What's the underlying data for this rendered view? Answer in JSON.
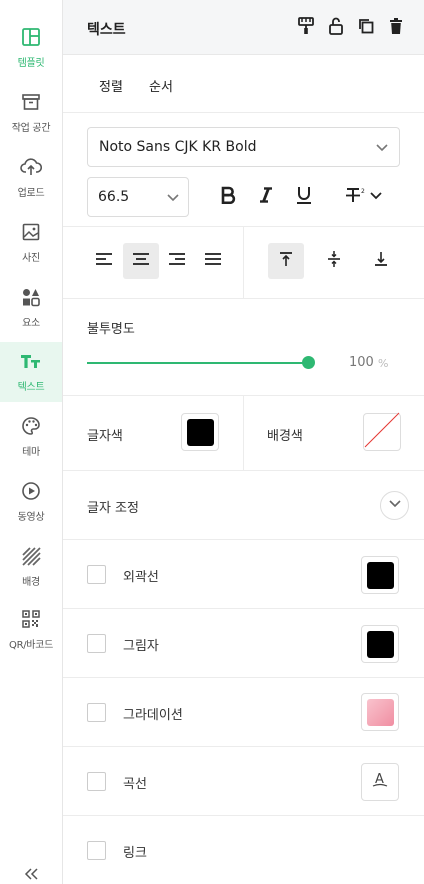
{
  "sidebar": {
    "items": [
      {
        "label": "템플릿",
        "icon": "template-icon",
        "active": true
      },
      {
        "label": "작업 공간",
        "icon": "archive-icon",
        "active": false
      },
      {
        "label": "업로드",
        "icon": "upload-cloud-icon",
        "active": false
      },
      {
        "label": "사진",
        "icon": "image-icon",
        "active": false
      },
      {
        "label": "요소",
        "icon": "shapes-icon",
        "active": false
      },
      {
        "label": "텍스트",
        "icon": "text-icon",
        "active": true
      },
      {
        "label": "테마",
        "icon": "palette-icon",
        "active": false
      },
      {
        "label": "동영상",
        "icon": "play-circle-icon",
        "active": false
      },
      {
        "label": "배경",
        "icon": "stripes-icon",
        "active": false
      },
      {
        "label": "QR/바코드",
        "icon": "qr-code-icon",
        "active": false
      }
    ],
    "collapse_icon": "double-chevron-left-icon"
  },
  "header": {
    "title": "텍스트",
    "icons": [
      "paint-roller-icon",
      "unlock-icon",
      "duplicate-icon",
      "trash-icon"
    ]
  },
  "tabs": [
    "정렬",
    "순서"
  ],
  "font": {
    "family": "Noto Sans CJK KR Bold",
    "size": "66.5"
  },
  "format_icons": [
    "bold-icon",
    "italic-icon",
    "underline-icon",
    "strikethrough-icon"
  ],
  "opacity": {
    "label": "불투명도",
    "value": "100",
    "unit": "%",
    "fraction": 1.0
  },
  "colors": {
    "text_color_label": "글자색",
    "text_color": "#000000",
    "bg_color_label": "배경색",
    "bg_color": "none",
    "accent": "#2eb872",
    "gradient_color": "#f4a6b4"
  },
  "text_adjust_label": "글자 조정",
  "effects": [
    {
      "label": "외곽선",
      "checked": false,
      "swatch": "#000000"
    },
    {
      "label": "그림자",
      "checked": false,
      "swatch": "#000000"
    },
    {
      "label": "그라데이션",
      "checked": false,
      "swatch": "#f4a6b4"
    },
    {
      "label": "곡선",
      "checked": false,
      "swatch": "curve-text-icon"
    },
    {
      "label": "링크",
      "checked": false
    }
  ]
}
